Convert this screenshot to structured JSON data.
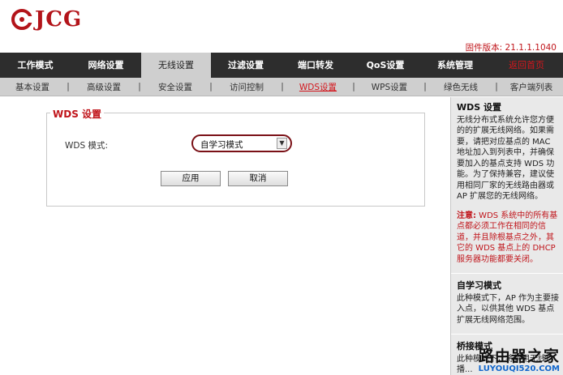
{
  "brand": {
    "name": "JCG",
    "color": "#b3141a"
  },
  "firmware": "固件版本: 21.1.1.1040",
  "main_nav": {
    "tabs": [
      {
        "label": "工作模式",
        "active": false
      },
      {
        "label": "网络设置",
        "active": false
      },
      {
        "label": "无线设置",
        "active": true
      },
      {
        "label": "过滤设置",
        "active": false
      },
      {
        "label": "端口转发",
        "active": false
      },
      {
        "label": "QoS设置",
        "active": false
      },
      {
        "label": "系统管理",
        "active": false
      }
    ],
    "home": "返回首页"
  },
  "sub_nav": {
    "items": [
      {
        "label": "基本设置",
        "active": false
      },
      {
        "label": "高级设置",
        "active": false
      },
      {
        "label": "安全设置",
        "active": false
      },
      {
        "label": "访问控制",
        "active": false
      },
      {
        "label": "WDS设置",
        "active": true
      },
      {
        "label": "WPS设置",
        "active": false
      },
      {
        "label": "绿色无线",
        "active": false
      },
      {
        "label": "客户端列表",
        "active": false
      }
    ],
    "separator": "|"
  },
  "wds": {
    "legend": "WDS 设置",
    "mode_label": "WDS 模式:",
    "mode_value": "自学习模式",
    "apply": "应用",
    "cancel": "取消"
  },
  "help": {
    "title": "WDS 设置",
    "body": "无线分布式系统允许您方便的的扩展无线网络。如果需要，请把对应基点的 MAC 地址加入到列表中，并确保要加入的基点支持 WDS 功能。为了保持兼容，建议使用相同厂家的无线路由器或 AP 扩展您的无线网络。",
    "note_prefix": "注意:",
    "note_body": " WDS 系统中的所有基点都必须工作在相同的信道，并且除根基点之外，其它的 WDS 基点上的 DHCP 服务器功能都要关闭。",
    "section2_title": "自学习模式",
    "section2_body": "此种模式下，AP 作为主要接入点，以供其他 WDS 基点扩展无线网络范围。",
    "section3_title": "桥接模式",
    "section3_body": "此种模式下，将禁用无线广播..."
  },
  "watermark": {
    "title": "路由器之家",
    "url": "LUYOUQI520.COM"
  },
  "colors": {
    "accent": "#c0141a",
    "nav_bg": "#2d2d2d",
    "subnav_bg": "#cfcfcf",
    "help_bg": "#e9e9e9"
  }
}
